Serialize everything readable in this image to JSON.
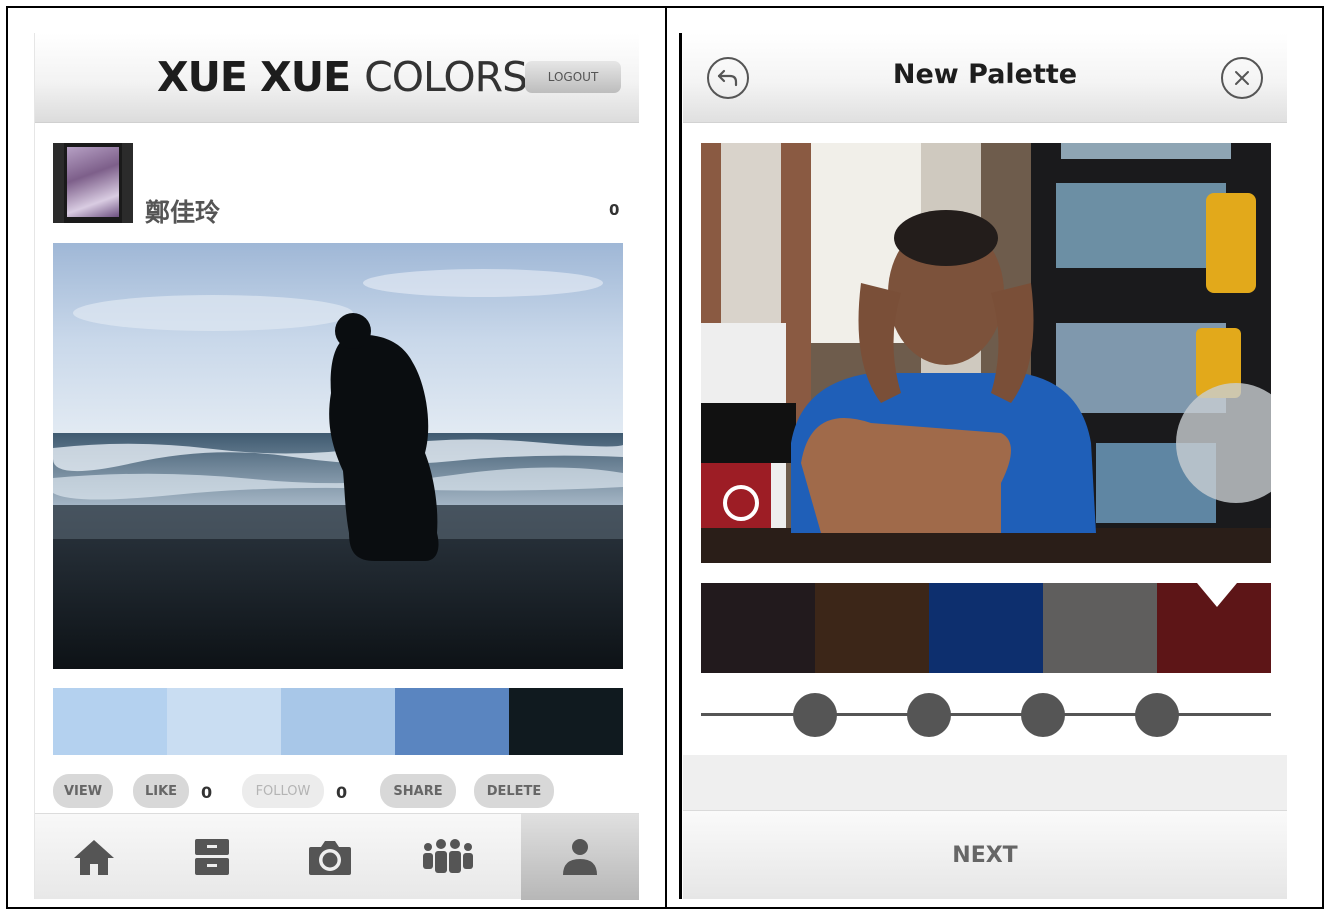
{
  "left": {
    "header": {
      "brand_bold": "XUE XUE",
      "brand_light": "COLORS",
      "logout_label": "LOGOUT"
    },
    "profile": {
      "username": "鄭佳玲",
      "count": "0"
    },
    "palette": [
      "#b4d1ef",
      "#c9ddf2",
      "#a8c7e8",
      "#5a85c0",
      "#101a1f"
    ],
    "actions": {
      "view": "VIEW",
      "like": "LIKE",
      "like_count": "0",
      "follow": "FOLLOW",
      "follow_count": "0",
      "share": "SHARE",
      "delete": "DELETE"
    },
    "tabs": [
      "home-icon",
      "archive-icon",
      "camera-icon",
      "group-icon",
      "person-icon"
    ]
  },
  "right": {
    "header": {
      "title": "New Palette"
    },
    "palette": [
      "#221a1d",
      "#3c2618",
      "#0d2f6e",
      "#5f5e5d",
      "#5d1517"
    ],
    "next_label": "NEXT"
  }
}
